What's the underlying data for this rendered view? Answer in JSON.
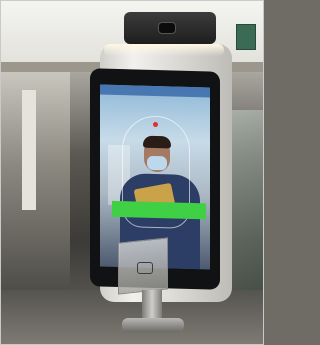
{
  "scene": {
    "description_colors": {
      "screen_frame": "#101214",
      "stand": "#e6e5e1",
      "verification_banner": "#3fd046",
      "status_bar": "#2f5fa0"
    },
    "screen": {
      "status_text": "",
      "banner_text": ""
    }
  }
}
